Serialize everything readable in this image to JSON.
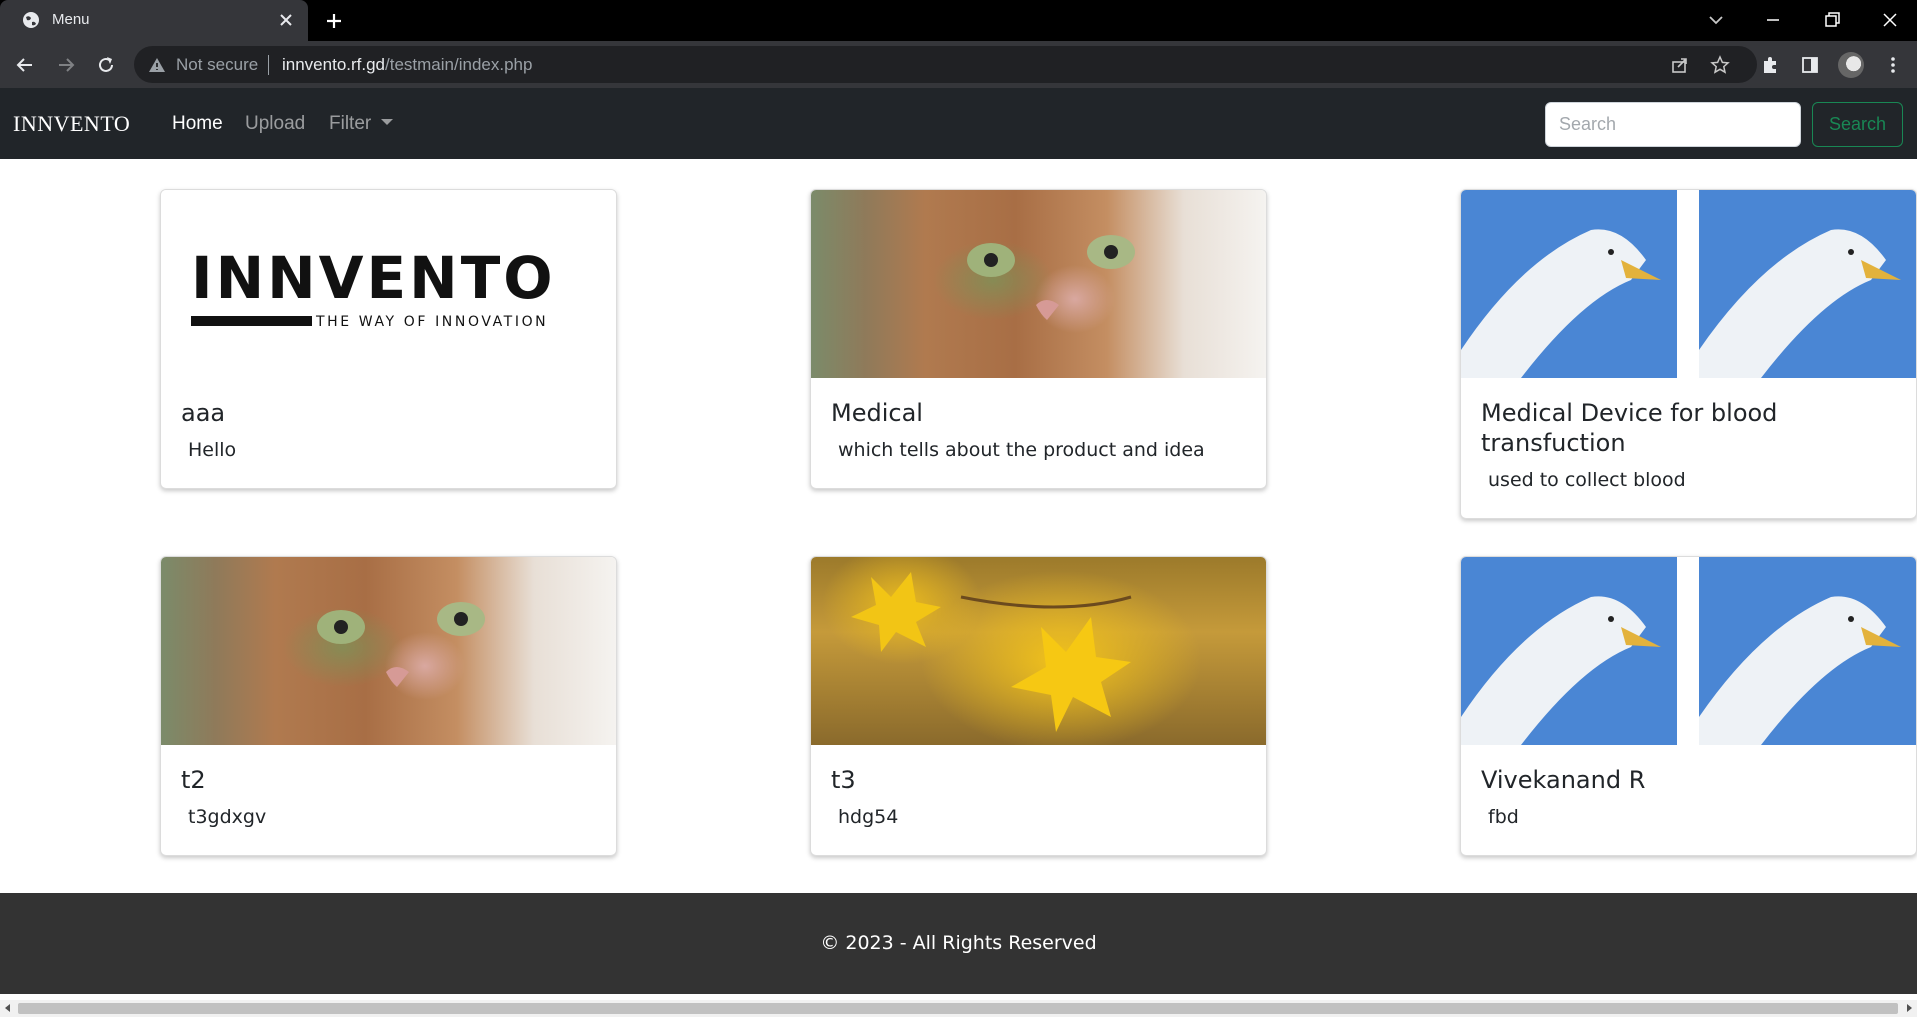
{
  "browser": {
    "tab_title": "Menu",
    "security_label": "Not secure",
    "url_host": "innvento.rf.gd",
    "url_path": "/testmain/index.php"
  },
  "navbar": {
    "brand": "INNVENTO",
    "links": [
      {
        "label": "Home",
        "active": true
      },
      {
        "label": "Upload",
        "active": false
      },
      {
        "label": "Filter",
        "active": false
      }
    ],
    "search_placeholder": "Search",
    "search_button": "Search"
  },
  "cards": [
    {
      "title": "aaa",
      "text": "Hello",
      "image": "innvento-logo"
    },
    {
      "title": "Medical",
      "text": "which tells about the product and idea",
      "image": "cat"
    },
    {
      "title": "Medical Device for blood transfuction",
      "text": "used to collect blood",
      "image": "seagulls"
    },
    {
      "title": "t2",
      "text": "t3gdxgv",
      "image": "cat"
    },
    {
      "title": "t3",
      "text": "hdg54",
      "image": "yellow-leaves"
    },
    {
      "title": "Vivekanand R",
      "text": "fbd",
      "image": "seagulls"
    }
  ],
  "logo_image": {
    "wordmark": "INNVENTO",
    "tagline": "THE WAY OF INNOVATION"
  },
  "footer": {
    "text": "© 2023 - All Rights Reserved"
  },
  "colors": {
    "navbar_bg": "#212529",
    "footer_bg": "#333333",
    "search_button": "#198754"
  }
}
